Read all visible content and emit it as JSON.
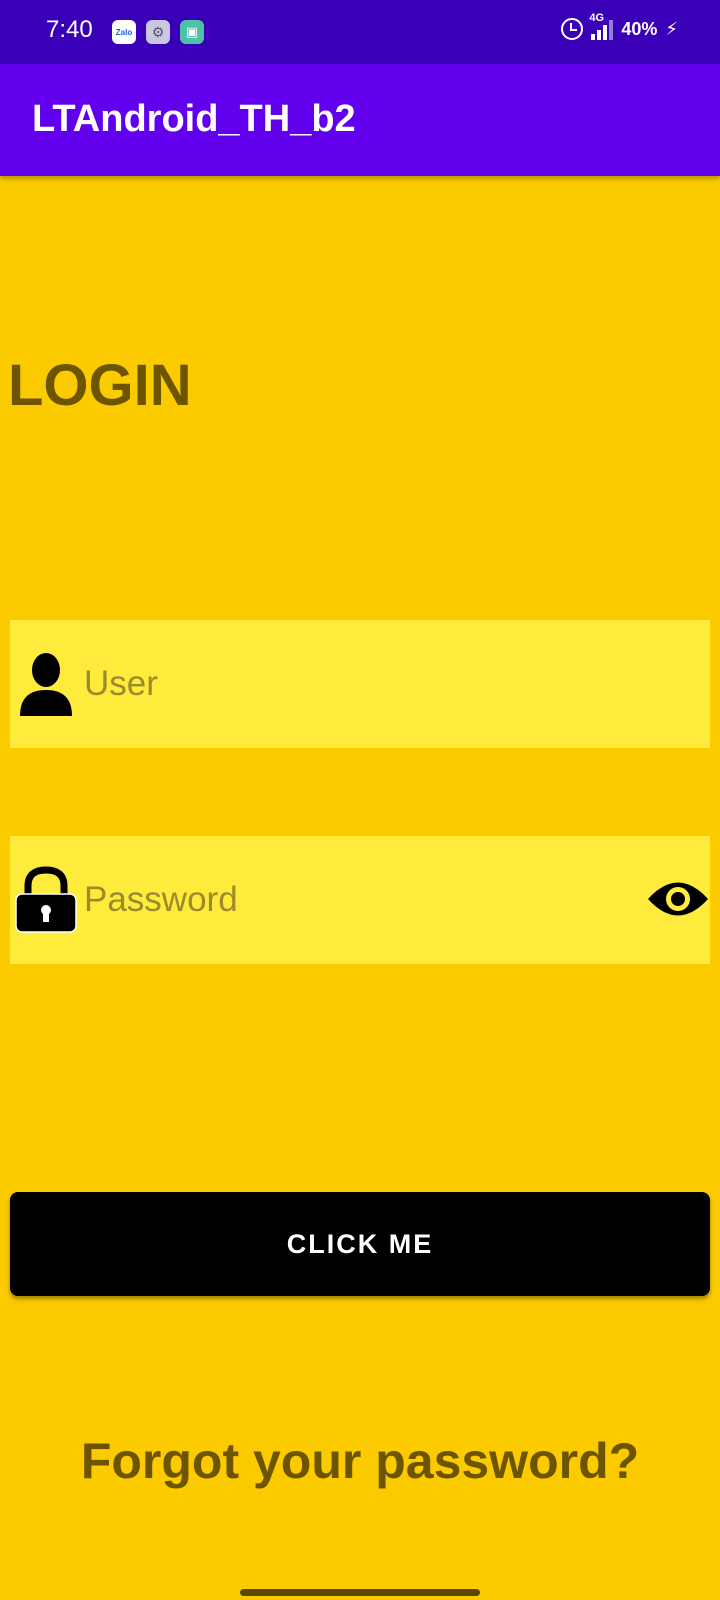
{
  "status_bar": {
    "time": "7:40",
    "notifications": [
      "Zalo",
      "settings-icon",
      "store-icon"
    ],
    "network": "4G",
    "battery": "40%"
  },
  "app_bar": {
    "title": "LTAndroid_TH_b2"
  },
  "login": {
    "heading": "LOGIN",
    "user_placeholder": "User",
    "password_placeholder": "Password",
    "button_label": "CLICK ME",
    "forgot_link": "Forgot your password?"
  },
  "colors": {
    "status_bar": "#3A00B8",
    "app_bar": "#6200EE",
    "background": "#FBCB00",
    "field_bg": "#FFEB3B",
    "text_dark": "#6D5500",
    "button": "#000000"
  }
}
